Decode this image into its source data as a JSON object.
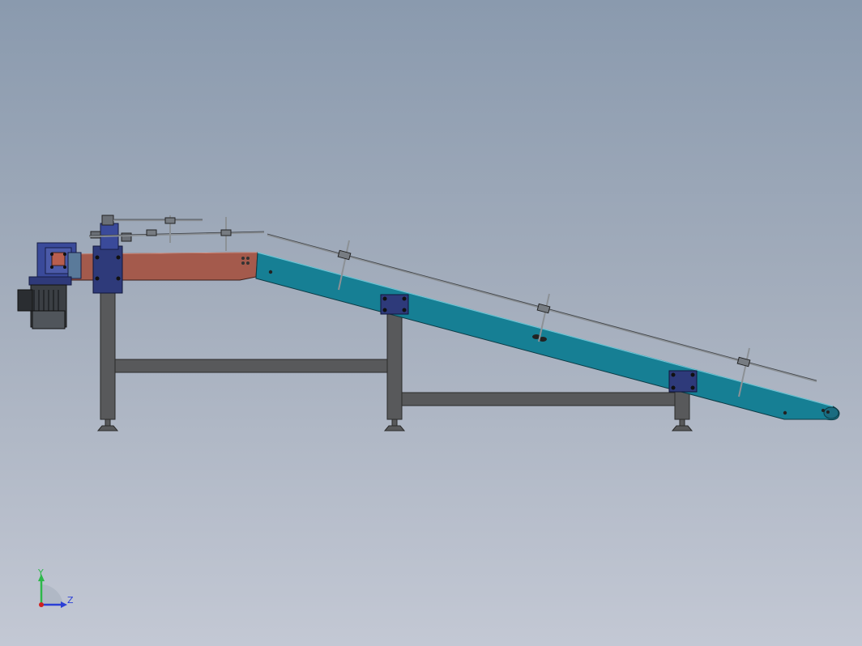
{
  "viewport": {
    "background_top": "#8a9aae",
    "background_bottom": "#c3c8d4"
  },
  "model": {
    "frame_color": "#58595b",
    "horizontal_section_color": "#a45a4c",
    "inclined_section_color": "#167f94",
    "drive_color": "#3a4a9a",
    "motor_color": "#3b3f44",
    "guide_rail_color": "#8c9196"
  },
  "triad": {
    "y_label": "Y",
    "z_label": "Z",
    "y_color": "#2db84a",
    "z_color": "#2b3fd6",
    "origin_color": "#d02020"
  }
}
